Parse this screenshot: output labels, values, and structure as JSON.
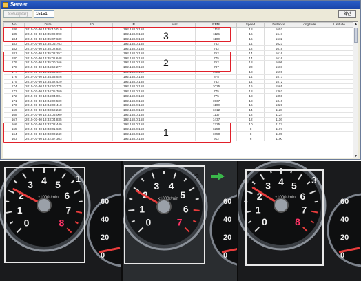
{
  "window": {
    "title": "Server",
    "setup_button": "Setup[Bar]",
    "port_value": "15151",
    "ok_button": "확인"
  },
  "table": {
    "columns": [
      "No",
      "Date",
      "ID",
      "IP",
      "Mac",
      "RPM",
      "Speed",
      "Distance",
      "Longitude",
      "Latitude"
    ],
    "rows": [
      [
        "186",
        "2015-01-30 13:35:10.010",
        "",
        "192.168.0.158",
        "",
        "1112",
        "18",
        "1651",
        "",
        ""
      ],
      [
        "185",
        "2015-01-30 13:35:09.090",
        "",
        "192.168.0.158",
        "",
        "1125",
        "16",
        "1647",
        "",
        ""
      ],
      [
        "184",
        "2015-01-30 13:35:07.639",
        "",
        "192.168.0.158",
        "",
        "1100",
        "16",
        "1632",
        "",
        ""
      ],
      [
        "183",
        "2015-01-30 13:35:05.763",
        "",
        "192.168.0.158",
        "",
        "762",
        "14",
        "1621",
        "",
        ""
      ],
      [
        "182",
        "2015-01-30 13:35:02.834",
        "",
        "192.168.0.158",
        "",
        "762",
        "12",
        "1619",
        "",
        ""
      ],
      [
        "181",
        "2015-01-30 13:35:02.257",
        "",
        "192.168.0.158",
        "",
        "762",
        "14",
        "1616",
        "",
        ""
      ],
      [
        "180",
        "2015-01-30 13:35:01.648",
        "",
        "192.168.0.158",
        "",
        "775",
        "14",
        "1616",
        "",
        ""
      ],
      [
        "179",
        "2015-01-30 13:35:00.166",
        "",
        "192.168.0.158",
        "",
        "762",
        "18",
        "1606",
        "",
        ""
      ],
      [
        "178",
        "2015-01-30 13:34:59.277",
        "",
        "192.168.0.158",
        "",
        "787",
        "20",
        "1603",
        "",
        ""
      ],
      [
        "177",
        "2015-01-30 13:34:56.394",
        "",
        "192.168.0.158",
        "",
        "1625",
        "18",
        "1590",
        "",
        ""
      ],
      [
        "176",
        "2015-01-30 13:34:53.926",
        "",
        "192.168.0.158",
        "",
        "875",
        "14",
        "1573",
        "",
        ""
      ],
      [
        "175",
        "2015-01-30 13:34:52.429",
        "",
        "192.168.0.158",
        "",
        "762",
        "14",
        "1572",
        "",
        ""
      ],
      [
        "174",
        "2015-01-30 13:34:50.775",
        "",
        "192.168.0.158",
        "",
        "1025",
        "16",
        "1565",
        "",
        ""
      ],
      [
        "173",
        "2015-01-30 13:34:05.769",
        "",
        "192.168.0.158",
        "",
        "775",
        "18",
        "1361",
        "",
        ""
      ],
      [
        "172",
        "2015-01-30 13:34:04.004",
        "",
        "192.168.0.158",
        "",
        "775",
        "18",
        "1359",
        "",
        ""
      ],
      [
        "171",
        "2015-01-30 13:34:02.509",
        "",
        "192.168.0.158",
        "",
        "1537",
        "18",
        "1346",
        "",
        ""
      ],
      [
        "170",
        "2015-01-30 13:34:00.418",
        "",
        "192.168.0.158",
        "",
        "1100",
        "16",
        "1321",
        "",
        ""
      ],
      [
        "169",
        "2015-01-30 13:33:58.240",
        "",
        "192.168.0.158",
        "",
        "1312",
        "14",
        "1128",
        "",
        ""
      ],
      [
        "168",
        "2015-01-30 13:33:06.009",
        "",
        "192.168.0.158",
        "",
        "1137",
        "12",
        "1124",
        "",
        ""
      ],
      [
        "167",
        "2015-01-30 13:33:04.835",
        "",
        "192.168.0.158",
        "",
        "1437",
        "12",
        "1116",
        "",
        ""
      ],
      [
        "166",
        "2015-01-30 13:33:02.449",
        "",
        "192.168.0.158",
        "",
        "1225",
        "10",
        "1113",
        "",
        ""
      ],
      [
        "165",
        "2015-01-30 13:33:01.635",
        "",
        "192.168.0.158",
        "",
        "1250",
        "8",
        "1107",
        "",
        ""
      ],
      [
        "164",
        "2015-01-30 13:33:00.249",
        "",
        "192.168.0.158",
        "",
        "1050",
        "8",
        "1105",
        "",
        ""
      ],
      [
        "163",
        "2015-01-30 13:32:57.363",
        "",
        "192.168.0.158",
        "",
        "912",
        "6",
        "1100",
        "",
        ""
      ]
    ]
  },
  "highlights": [
    {
      "label": "3"
    },
    {
      "label": "2"
    },
    {
      "label": "1"
    }
  ],
  "photos": [
    {
      "label": "1",
      "gauge_text": "x1000r/min",
      "ticks": [
        "0",
        "1",
        "2",
        "3",
        "4",
        "5",
        "6",
        "7",
        "8"
      ]
    },
    {
      "label": "2",
      "gauge_text": "x1000r/min",
      "ticks": [
        "0",
        "1",
        "2",
        "3",
        "4",
        "5",
        "6",
        "7"
      ]
    },
    {
      "label": "3",
      "gauge_text": "x1000r/min",
      "ticks": [
        "0",
        "1",
        "2",
        "3",
        "4",
        "5",
        "6",
        "7",
        "8"
      ]
    }
  ],
  "side_gauge_ticks": [
    "60",
    "40",
    "20",
    "0"
  ],
  "colors": {
    "highlight": "#e0202a",
    "needle": "#e83c3c",
    "arrow": "#3ab84a"
  }
}
